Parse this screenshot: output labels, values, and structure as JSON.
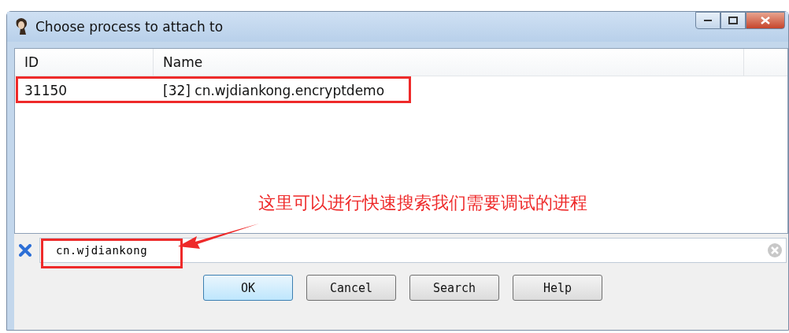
{
  "window": {
    "title": "Choose process to attach to"
  },
  "table": {
    "columns": [
      "ID",
      "Name"
    ],
    "rows": [
      {
        "id": "31150",
        "name": "[32] cn.wjdiankong.encryptdemo",
        "selected": false
      }
    ]
  },
  "filter": {
    "value": "cn.wjdiankong"
  },
  "buttons": [
    {
      "label": "OK",
      "default": true
    },
    {
      "label": "Cancel",
      "default": false
    },
    {
      "label": "Search",
      "default": false
    },
    {
      "label": "Help",
      "default": false
    }
  ],
  "annotation": {
    "text": "这里可以进行快速搜索我们需要调试的进程"
  }
}
